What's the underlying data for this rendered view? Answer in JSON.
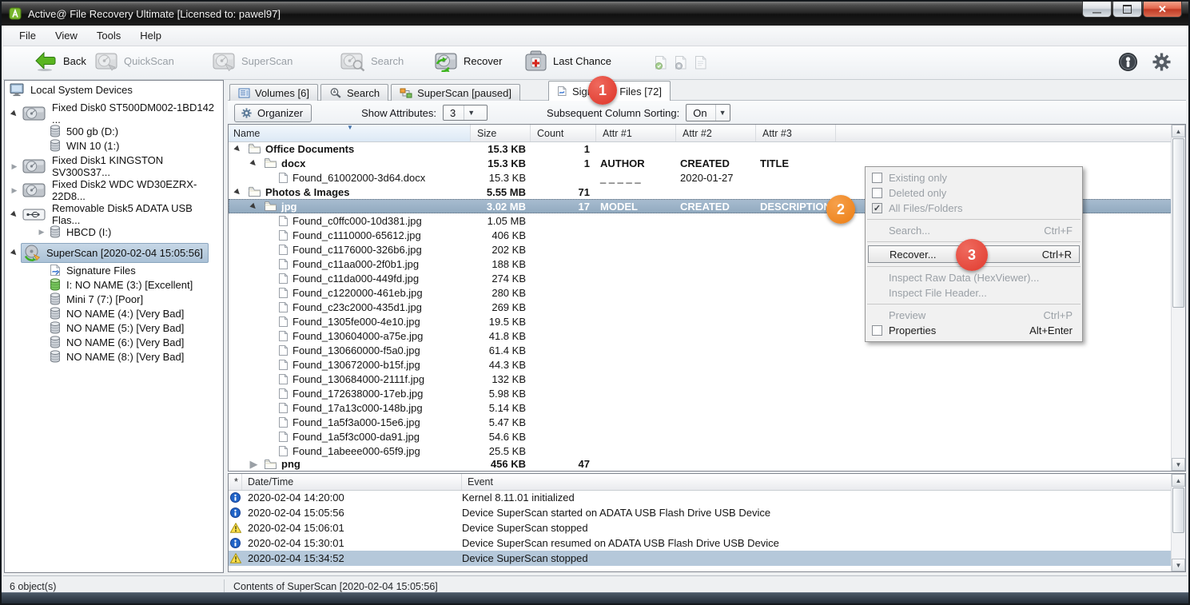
{
  "window": {
    "title": "Active@ File Recovery Ultimate [Licensed to: pawel97]"
  },
  "menu": {
    "items": [
      "File",
      "View",
      "Tools",
      "Help"
    ]
  },
  "toolbar": {
    "buttons": [
      {
        "label": "Back",
        "icon": "back-icon",
        "enabled": true
      },
      {
        "label": "QuickScan",
        "icon": "quickscan-icon",
        "enabled": false
      },
      {
        "label": "SuperScan",
        "icon": "superscan-hdd-icon",
        "enabled": false
      },
      {
        "label": "Search",
        "icon": "search-hdd-icon",
        "enabled": false
      },
      {
        "label": "Recover",
        "icon": "recover-icon",
        "enabled": true
      },
      {
        "label": "Last Chance",
        "icon": "lastchance-icon",
        "enabled": true
      }
    ],
    "small_icons": [
      "doc-check-icon",
      "doc-delete-icon",
      "doc-blank-icon"
    ],
    "right_icons": [
      "about-icon",
      "settings-gear-icon"
    ]
  },
  "sidebar": {
    "header": "Local System Devices",
    "items": [
      {
        "label": "Fixed Disk0 ST500DM002-1BD142 ...",
        "icon": "hdd-icon",
        "expander": "expanded",
        "level": 0,
        "kind": "device"
      },
      {
        "label": "500 gb (D:)",
        "icon": "volume-icon",
        "expander": "none",
        "level": 1,
        "kind": "volume"
      },
      {
        "label": "WIN 10 (1:)",
        "icon": "volume-icon",
        "expander": "none",
        "level": 1,
        "kind": "volume"
      },
      {
        "label": "Fixed Disk1 KINGSTON SV300S37...",
        "icon": "hdd-icon",
        "expander": "collapsed",
        "level": 0,
        "kind": "device"
      },
      {
        "label": "Fixed Disk2 WDC WD30EZRX-22D8...",
        "icon": "hdd-icon",
        "expander": "collapsed",
        "level": 0,
        "kind": "device"
      },
      {
        "label": "Removable Disk5 ADATA USB Flas...",
        "icon": "usb-icon",
        "expander": "expanded",
        "level": 0,
        "kind": "device"
      },
      {
        "label": "HBCD (I:)",
        "icon": "volume-icon",
        "expander": "collapsed",
        "level": 1,
        "kind": "volume"
      },
      {
        "label": "SuperScan [2020-02-04 15:05:56]",
        "icon": "superscan-tree-icon",
        "expander": "expanded",
        "level": 0,
        "kind": "device",
        "selected": true
      },
      {
        "label": "Signature Files",
        "icon": "signature-doc-icon",
        "expander": "none",
        "level": 1,
        "kind": "volume"
      },
      {
        "label": "I: NO NAME (3:) [Excellent]",
        "icon": "volume-green-icon",
        "expander": "none",
        "level": 1,
        "kind": "volume"
      },
      {
        "label": "Mini 7 (7:) [Poor]",
        "icon": "volume-icon",
        "expander": "none",
        "level": 1,
        "kind": "volume"
      },
      {
        "label": "NO NAME (4:) [Very Bad]",
        "icon": "volume-icon",
        "expander": "none",
        "level": 1,
        "kind": "volume"
      },
      {
        "label": "NO NAME (5:) [Very Bad]",
        "icon": "volume-icon",
        "expander": "none",
        "level": 1,
        "kind": "volume"
      },
      {
        "label": "NO NAME (6:) [Very Bad]",
        "icon": "volume-icon",
        "expander": "none",
        "level": 1,
        "kind": "volume"
      },
      {
        "label": "NO NAME (8:) [Very Bad]",
        "icon": "volume-icon",
        "expander": "none",
        "level": 1,
        "kind": "volume"
      }
    ]
  },
  "tabs": [
    {
      "label": "Volumes [6]",
      "icon": "volumes-tab-icon",
      "active": false
    },
    {
      "label": "Search",
      "icon": "search-tab-icon",
      "active": false
    },
    {
      "label": "SuperScan [paused]",
      "icon": "superscan-tab-icon",
      "active": false
    },
    {
      "label": "Signature Files [72]",
      "icon": "signature-tab-icon",
      "active": true
    }
  ],
  "subtoolbar": {
    "organizer_label": "Organizer",
    "attributes_label": "Show Attributes:",
    "attributes_value": "3",
    "sorting_label": "Subsequent Column Sorting:",
    "sorting_value": "On"
  },
  "file_table": {
    "columns": [
      "Name",
      "Size",
      "Count",
      "Attr #1",
      "Attr #2",
      "Attr #3"
    ],
    "rows": [
      {
        "name": "Office Documents",
        "type": "folder",
        "expander": "expanded",
        "level": 0,
        "size": "15.3 KB",
        "count": "1",
        "a1": "",
        "a2": "",
        "a3": ""
      },
      {
        "name": "docx",
        "type": "folder",
        "expander": "expanded",
        "level": 1,
        "size": "15.3 KB",
        "count": "1",
        "a1": "AUTHOR",
        "a2": "CREATED",
        "a3": "TITLE"
      },
      {
        "name": "Found_61002000-3d64.docx",
        "type": "file",
        "level": 2,
        "size": "15.3 KB",
        "count": "",
        "a1": "_ _ _  _ _",
        "a2": "2020-01-27",
        "a3": ""
      },
      {
        "name": "Photos & Images",
        "type": "folder",
        "expander": "expanded",
        "level": 0,
        "size": "5.55 MB",
        "count": "71",
        "a1": "",
        "a2": "",
        "a3": ""
      },
      {
        "name": "jpg",
        "type": "folder",
        "expander": "expanded",
        "level": 1,
        "size": "3.02 MB",
        "count": "17",
        "a1": "MODEL",
        "a2": "CREATED",
        "a3": "DESCRIPTION",
        "selected": true
      },
      {
        "name": "Found_c0ffc000-10d381.jpg",
        "type": "file",
        "level": 2,
        "size": "1.05 MB"
      },
      {
        "name": "Found_c1110000-65612.jpg",
        "type": "file",
        "level": 2,
        "size": "406 KB"
      },
      {
        "name": "Found_c1176000-326b6.jpg",
        "type": "file",
        "level": 2,
        "size": "202 KB"
      },
      {
        "name": "Found_c11aa000-2f0b1.jpg",
        "type": "file",
        "level": 2,
        "size": "188 KB"
      },
      {
        "name": "Found_c11da000-449fd.jpg",
        "type": "file",
        "level": 2,
        "size": "274 KB"
      },
      {
        "name": "Found_c1220000-461eb.jpg",
        "type": "file",
        "level": 2,
        "size": "280 KB"
      },
      {
        "name": "Found_c23c2000-435d1.jpg",
        "type": "file",
        "level": 2,
        "size": "269 KB"
      },
      {
        "name": "Found_1305fe000-4e10.jpg",
        "type": "file",
        "level": 2,
        "size": "19.5 KB"
      },
      {
        "name": "Found_130604000-a75e.jpg",
        "type": "file",
        "level": 2,
        "size": "41.8 KB"
      },
      {
        "name": "Found_130660000-f5a0.jpg",
        "type": "file",
        "level": 2,
        "size": "61.4 KB"
      },
      {
        "name": "Found_130672000-b15f.jpg",
        "type": "file",
        "level": 2,
        "size": "44.3 KB"
      },
      {
        "name": "Found_130684000-2111f.jpg",
        "type": "file",
        "level": 2,
        "size": "132 KB"
      },
      {
        "name": "Found_172638000-17eb.jpg",
        "type": "file",
        "level": 2,
        "size": "5.98 KB"
      },
      {
        "name": "Found_17a13c000-148b.jpg",
        "type": "file",
        "level": 2,
        "size": "5.14 KB"
      },
      {
        "name": "Found_1a5f3a000-15e6.jpg",
        "type": "file",
        "level": 2,
        "size": "5.47 KB"
      },
      {
        "name": "Found_1a5f3c000-da91.jpg",
        "type": "file",
        "level": 2,
        "size": "54.6 KB"
      },
      {
        "name": "Found_1abeee000-65f9.jpg",
        "type": "file",
        "level": 2,
        "size": "25.5 KB"
      },
      {
        "name": "png",
        "type": "folder",
        "expander": "collapsed",
        "level": 1,
        "size": "456 KB",
        "count": "47",
        "clipped": true
      }
    ]
  },
  "context_menu": {
    "items": [
      {
        "type": "check",
        "checked": false,
        "label": "Existing only",
        "enabled": false
      },
      {
        "type": "check",
        "checked": false,
        "label": "Deleted only",
        "enabled": false
      },
      {
        "type": "check",
        "checked": true,
        "label": "All Files/Folders",
        "enabled": false
      },
      {
        "type": "sep"
      },
      {
        "type": "item",
        "label": "Search...",
        "shortcut": "Ctrl+F",
        "enabled": false
      },
      {
        "type": "sep"
      },
      {
        "type": "item",
        "label": "Recover...",
        "shortcut": "Ctrl+R",
        "enabled": true,
        "highlighted": true
      },
      {
        "type": "sep"
      },
      {
        "type": "item",
        "label": "Inspect Raw Data (HexViewer)...",
        "enabled": false
      },
      {
        "type": "item",
        "label": "Inspect File Header...",
        "enabled": false
      },
      {
        "type": "sep"
      },
      {
        "type": "item",
        "label": "Preview",
        "shortcut": "Ctrl+P",
        "enabled": false
      },
      {
        "type": "check",
        "checked": false,
        "label": "Properties",
        "shortcut": "Alt+Enter",
        "enabled": true
      }
    ]
  },
  "log": {
    "columns": [
      "*",
      "Date/Time",
      "Event"
    ],
    "rows": [
      {
        "icon": "info",
        "time": "2020-02-04 14:20:00",
        "event": "Kernel 8.11.01 initialized"
      },
      {
        "icon": "info",
        "time": "2020-02-04 15:05:56",
        "event": "Device SuperScan started on ADATA USB Flash Drive USB Device"
      },
      {
        "icon": "warning",
        "time": "2020-02-04 15:06:01",
        "event": "Device SuperScan stopped"
      },
      {
        "icon": "info",
        "time": "2020-02-04 15:30:01",
        "event": "Device SuperScan resumed on ADATA USB Flash Drive USB Device"
      },
      {
        "icon": "warning",
        "time": "2020-02-04 15:34:52",
        "event": "Device SuperScan stopped",
        "selected": true
      }
    ]
  },
  "statusbar": {
    "left": "6 object(s)",
    "right": "Contents of SuperScan [2020-02-04 15:05:56]"
  },
  "badges": [
    "1",
    "2",
    "3"
  ],
  "colors": {
    "selection": "#9fb4c8",
    "badge_red": "#e03a2e",
    "badge_orange": "#ec7d12",
    "titlebar": "#1f1f1f"
  }
}
